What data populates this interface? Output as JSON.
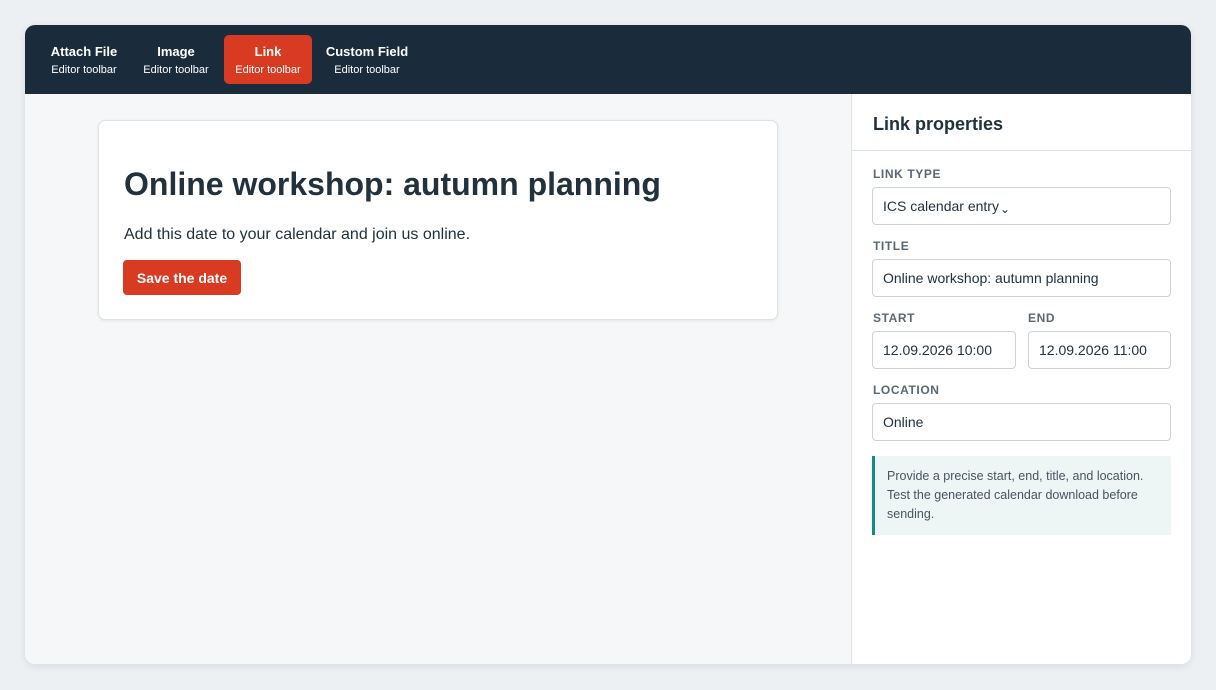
{
  "toolbar": {
    "items": [
      {
        "title": "Attach File",
        "subtitle": "Editor toolbar"
      },
      {
        "title": "Image",
        "subtitle": "Editor toolbar"
      },
      {
        "title": "Link",
        "subtitle": "Editor toolbar",
        "active": true
      },
      {
        "title": "Custom Field",
        "subtitle": "Editor toolbar"
      }
    ]
  },
  "canvas": {
    "card": {
      "title": "Online workshop: autumn planning",
      "text": "Add this date to your calendar and join us online.",
      "button_label": "Save the date"
    }
  },
  "panel": {
    "title": "Link properties",
    "link_type": {
      "label": "LINK TYPE",
      "value": "ICS calendar entry"
    },
    "title_field": {
      "label": "TITLE",
      "value": "Online workshop: autumn planning"
    },
    "start": {
      "label": "START",
      "value": "12.09.2026 10:00"
    },
    "end": {
      "label": "END",
      "value": "12.09.2026 11:00"
    },
    "location": {
      "label": "LOCATION",
      "value": "Online"
    },
    "note": "Provide a precise start, end, title, and location. Test the generated calendar download before sending."
  },
  "colors": {
    "toolbar_bg": "#1a2b3b",
    "accent": "#d93a22",
    "note_border": "#138a8a",
    "note_bg": "#eef5f5",
    "page_bg": "#edf0f3"
  },
  "icons": {
    "select_chevron": "chevron-down-icon"
  }
}
